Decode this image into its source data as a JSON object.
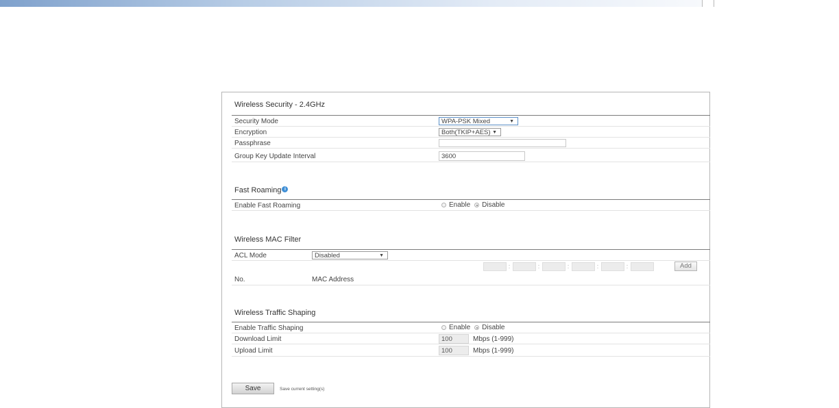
{
  "security": {
    "title": "Wireless Security - 2.4GHz",
    "mode_label": "Security Mode",
    "mode_value": "WPA-PSK Mixed",
    "encryption_label": "Encryption",
    "encryption_value": "Both(TKIP+AES)",
    "passphrase_label": "Passphrase",
    "passphrase_value": "",
    "group_key_label": "Group Key Update Interval",
    "group_key_value": "3600"
  },
  "roaming": {
    "title": "Fast Roaming",
    "enable_label": "Enable Fast Roaming",
    "options": [
      "Enable",
      "Disable"
    ],
    "selected": "Disable"
  },
  "mac_filter": {
    "title": "Wireless MAC Filter",
    "acl_label": "ACL Mode",
    "acl_value": "Disabled",
    "add_label": "Add",
    "col_no": "No.",
    "col_mac": "MAC Address"
  },
  "traffic": {
    "title": "Wireless Traffic Shaping",
    "enable_label": "Enable Traffic Shaping",
    "options": [
      "Enable",
      "Disable"
    ],
    "selected": "Disable",
    "download_label": "Download Limit",
    "download_value": "100",
    "upload_label": "Upload Limit",
    "upload_value": "100",
    "unit": "Mbps (1-999)"
  },
  "actions": {
    "save_label": "Save",
    "save_note": "Save current setting(s)"
  },
  "icons": {
    "info": "info-icon",
    "dropdown": "caret-down-icon"
  },
  "colors": {
    "accent": "#3f8fd6",
    "header_gradient_start": "#7fa1cc"
  }
}
